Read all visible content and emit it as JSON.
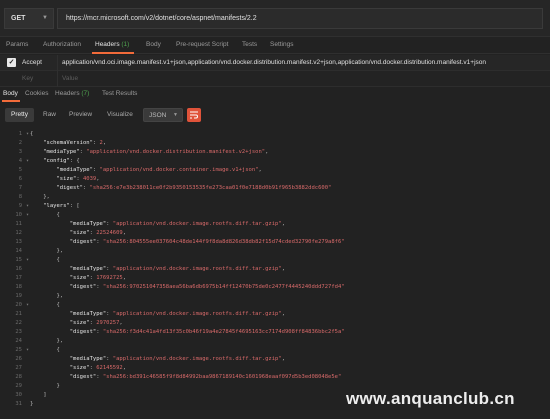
{
  "request": {
    "method": "GET",
    "url": "https://mcr.microsoft.com/v2/dotnet/core/aspnet/manifests/2.2"
  },
  "request_tabs": [
    {
      "label": "Params",
      "count": ""
    },
    {
      "label": "Authorization",
      "count": ""
    },
    {
      "label": "Headers",
      "count": "(1)"
    },
    {
      "label": "Body",
      "count": ""
    },
    {
      "label": "Pre-request Script",
      "count": ""
    },
    {
      "label": "Tests",
      "count": ""
    },
    {
      "label": "Settings",
      "count": ""
    }
  ],
  "headers": {
    "row": {
      "key": "Accept",
      "value": "application/vnd.oci.image.manifest.v1+json,application/vnd.docker.distribution.manifest.v2+json,application/vnd.docker.distribution.manifest.v1+json"
    },
    "placeholder": {
      "key": "Key",
      "value": "Value"
    }
  },
  "response_tabs": [
    {
      "label": "Body",
      "count": ""
    },
    {
      "label": "Cookies",
      "count": ""
    },
    {
      "label": "Headers",
      "count": "(7)"
    },
    {
      "label": "Test Results",
      "count": ""
    }
  ],
  "view": {
    "buttons": [
      "Pretty",
      "Raw",
      "Preview",
      "Visualize"
    ],
    "format": "JSON"
  },
  "body_lines": [
    {
      "n": "1",
      "fold": "▾",
      "t": [
        [
          "p",
          "{"
        ]
      ]
    },
    {
      "n": "2",
      "fold": "",
      "t": [
        [
          "k",
          "    \"schemaVersion\""
        ],
        [
          "p",
          ": "
        ],
        [
          "n",
          "2"
        ],
        [
          "p",
          ","
        ]
      ]
    },
    {
      "n": "3",
      "fold": "",
      "t": [
        [
          "k",
          "    \"mediaType\""
        ],
        [
          "p",
          ": "
        ],
        [
          "s",
          "\"application/vnd.docker.distribution.manifest.v2+json\""
        ],
        [
          "p",
          ","
        ]
      ]
    },
    {
      "n": "4",
      "fold": "▾",
      "t": [
        [
          "k",
          "    \"config\""
        ],
        [
          "p",
          ": {"
        ]
      ]
    },
    {
      "n": "5",
      "fold": "",
      "t": [
        [
          "k",
          "        \"mediaType\""
        ],
        [
          "p",
          ": "
        ],
        [
          "s",
          "\"application/vnd.docker.container.image.v1+json\""
        ],
        [
          "p",
          ","
        ]
      ]
    },
    {
      "n": "6",
      "fold": "",
      "t": [
        [
          "k",
          "        \"size\""
        ],
        [
          "p",
          ": "
        ],
        [
          "n",
          "4039"
        ],
        [
          "p",
          ","
        ]
      ]
    },
    {
      "n": "7",
      "fold": "",
      "t": [
        [
          "k",
          "        \"digest\""
        ],
        [
          "p",
          ": "
        ],
        [
          "s",
          "\"sha256:e7e3b238011ce0f2b9350153535fe273caa01f0e7188d0b91f965b3882ddc600\""
        ]
      ]
    },
    {
      "n": "8",
      "fold": "",
      "t": [
        [
          "p",
          "    },"
        ]
      ]
    },
    {
      "n": "9",
      "fold": "▾",
      "t": [
        [
          "k",
          "    \"layers\""
        ],
        [
          "p",
          ": ["
        ]
      ]
    },
    {
      "n": "10",
      "fold": "▾",
      "t": [
        [
          "p",
          "        {"
        ]
      ]
    },
    {
      "n": "11",
      "fold": "",
      "t": [
        [
          "k",
          "            \"mediaType\""
        ],
        [
          "p",
          ": "
        ],
        [
          "s",
          "\"application/vnd.docker.image.rootfs.diff.tar.gzip\""
        ],
        [
          "p",
          ","
        ]
      ]
    },
    {
      "n": "12",
      "fold": "",
      "t": [
        [
          "k",
          "            \"size\""
        ],
        [
          "p",
          ": "
        ],
        [
          "n",
          "22524609"
        ],
        [
          "p",
          ","
        ]
      ]
    },
    {
      "n": "13",
      "fold": "",
      "t": [
        [
          "k",
          "            \"digest\""
        ],
        [
          "p",
          ": "
        ],
        [
          "s",
          "\"sha256:804555ee037604c48de144f9f8da8d826d38db82f15d74cded32790fe279a8f6\""
        ]
      ]
    },
    {
      "n": "14",
      "fold": "",
      "t": [
        [
          "p",
          "        },"
        ]
      ]
    },
    {
      "n": "15",
      "fold": "▾",
      "t": [
        [
          "p",
          "        {"
        ]
      ]
    },
    {
      "n": "16",
      "fold": "",
      "t": [
        [
          "k",
          "            \"mediaType\""
        ],
        [
          "p",
          ": "
        ],
        [
          "s",
          "\"application/vnd.docker.image.rootfs.diff.tar.gzip\""
        ],
        [
          "p",
          ","
        ]
      ]
    },
    {
      "n": "17",
      "fold": "",
      "t": [
        [
          "k",
          "            \"size\""
        ],
        [
          "p",
          ": "
        ],
        [
          "n",
          "17692725"
        ],
        [
          "p",
          ","
        ]
      ]
    },
    {
      "n": "18",
      "fold": "",
      "t": [
        [
          "k",
          "            \"digest\""
        ],
        [
          "p",
          ": "
        ],
        [
          "s",
          "\"sha256:970251047358aea56ba6db6975b14ff12470b75de0c2477f4445240ddd727fd4\""
        ]
      ]
    },
    {
      "n": "19",
      "fold": "",
      "t": [
        [
          "p",
          "        },"
        ]
      ]
    },
    {
      "n": "20",
      "fold": "▾",
      "t": [
        [
          "p",
          "        {"
        ]
      ]
    },
    {
      "n": "21",
      "fold": "",
      "t": [
        [
          "k",
          "            \"mediaType\""
        ],
        [
          "p",
          ": "
        ],
        [
          "s",
          "\"application/vnd.docker.image.rootfs.diff.tar.gzip\""
        ],
        [
          "p",
          ","
        ]
      ]
    },
    {
      "n": "22",
      "fold": "",
      "t": [
        [
          "k",
          "            \"size\""
        ],
        [
          "p",
          ": "
        ],
        [
          "n",
          "2970257"
        ],
        [
          "p",
          ","
        ]
      ]
    },
    {
      "n": "23",
      "fold": "",
      "t": [
        [
          "k",
          "            \"digest\""
        ],
        [
          "p",
          ": "
        ],
        [
          "s",
          "\"sha256:f3d4c41a4fd13f35c0b46f19a4e27845f4695163cc7174d908ff84836bbc2f5a\""
        ]
      ]
    },
    {
      "n": "24",
      "fold": "",
      "t": [
        [
          "p",
          "        },"
        ]
      ]
    },
    {
      "n": "25",
      "fold": "▾",
      "t": [
        [
          "p",
          "        {"
        ]
      ]
    },
    {
      "n": "26",
      "fold": "",
      "t": [
        [
          "k",
          "            \"mediaType\""
        ],
        [
          "p",
          ": "
        ],
        [
          "s",
          "\"application/vnd.docker.image.rootfs.diff.tar.gzip\""
        ],
        [
          "p",
          ","
        ]
      ]
    },
    {
      "n": "27",
      "fold": "",
      "t": [
        [
          "k",
          "            \"size\""
        ],
        [
          "p",
          ": "
        ],
        [
          "n",
          "62145592"
        ],
        [
          "p",
          ","
        ]
      ]
    },
    {
      "n": "28",
      "fold": "",
      "t": [
        [
          "k",
          "            \"digest\""
        ],
        [
          "p",
          ": "
        ],
        [
          "s",
          "\"sha256:bd391c46585f9f8d84992baa9867189140c1601968eaaf097d5b3ed08048e5e\""
        ]
      ]
    },
    {
      "n": "29",
      "fold": "",
      "t": [
        [
          "p",
          "        }"
        ]
      ]
    },
    {
      "n": "30",
      "fold": "",
      "t": [
        [
          "p",
          "    ]"
        ]
      ]
    },
    {
      "n": "31",
      "fold": "",
      "t": [
        [
          "p",
          "}"
        ]
      ]
    }
  ],
  "watermark": "www.anquanclub.cn",
  "colors": {
    "accent": "#f26b3a",
    "string": "#d96a6a",
    "key": "#e6e6e6",
    "count_green": "#4fa34f"
  }
}
